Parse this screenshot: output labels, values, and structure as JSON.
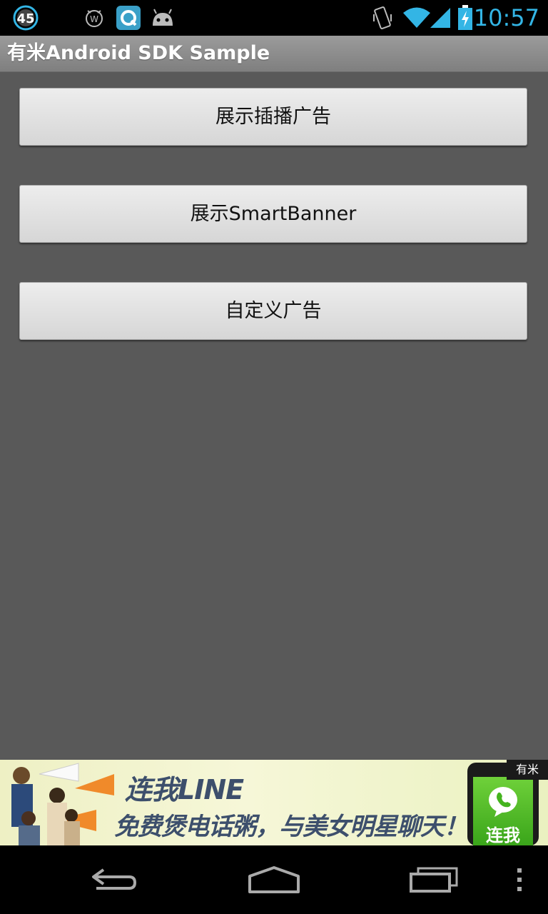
{
  "status_bar": {
    "notification_count": "45",
    "time": "10:57",
    "icons": [
      "notification-count-icon",
      "alarm-icon",
      "app-notification-icon",
      "android-icon",
      "vibrate-icon",
      "wifi-icon",
      "signal-icon",
      "battery-charging-icon"
    ],
    "accent_color": "#33b5e5"
  },
  "title_bar": {
    "title": "有米Android SDK Sample"
  },
  "buttons": [
    {
      "label": "展示插播广告"
    },
    {
      "label": "展示SmartBanner"
    },
    {
      "label": "自定义广告"
    }
  ],
  "ad_banner": {
    "headline": "连我LINE",
    "subline": "免费煲电话粥，与美女明星聊天！",
    "call_to_action": "连我",
    "badge": "有米",
    "app_icon": "line-phone-icon"
  },
  "nav_bar": {
    "icons": [
      "back-icon",
      "home-icon",
      "recent-apps-icon",
      "menu-icon"
    ]
  }
}
